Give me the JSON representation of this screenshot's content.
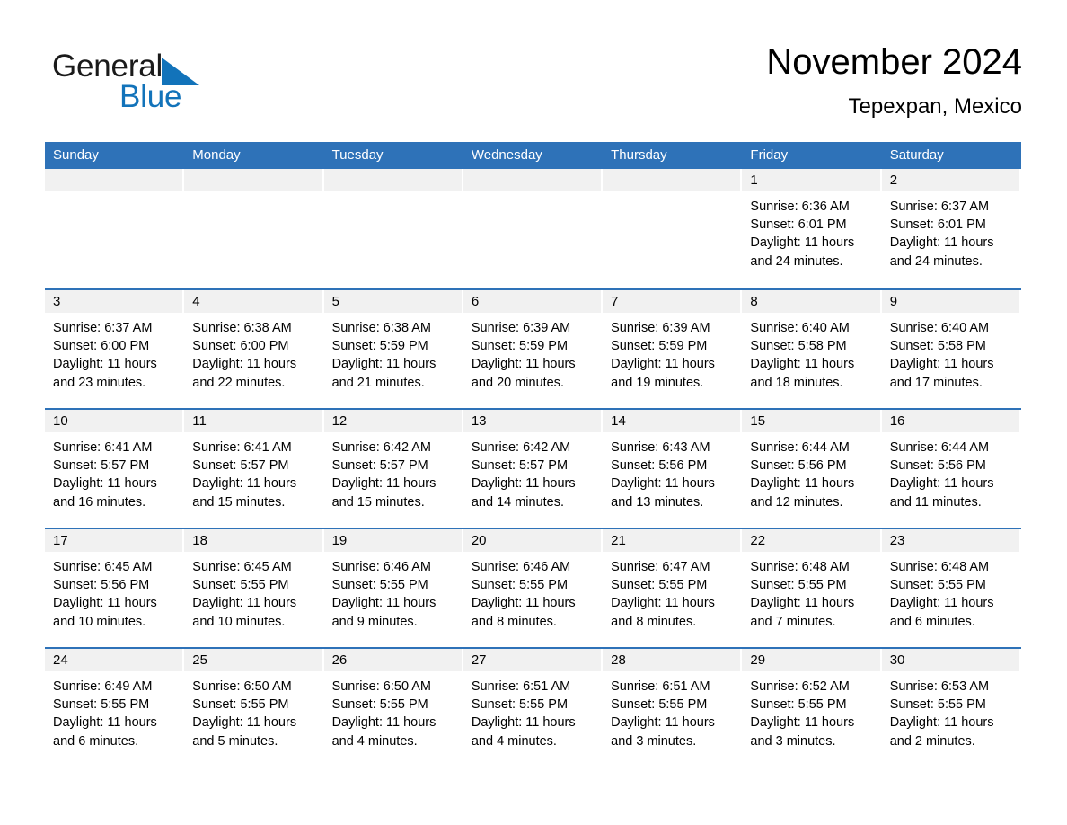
{
  "brand": {
    "name_part1": "General",
    "name_part2": "Blue",
    "triangle_color": "#1273ba",
    "text_color": "#1a1a1a"
  },
  "header": {
    "month_title": "November 2024",
    "location": "Tepexpan, Mexico"
  },
  "colors": {
    "header_blue": "#2e72b8",
    "daynum_band": "#f1f1f1",
    "row_divider": "#2e72b8",
    "text": "#000000"
  },
  "calendar": {
    "weekday_headers": [
      "Sunday",
      "Monday",
      "Tuesday",
      "Wednesday",
      "Thursday",
      "Friday",
      "Saturday"
    ],
    "weeks": [
      [
        {
          "day": "",
          "sunrise": "",
          "sunset": "",
          "daylight": "",
          "empty": true
        },
        {
          "day": "",
          "sunrise": "",
          "sunset": "",
          "daylight": "",
          "empty": true
        },
        {
          "day": "",
          "sunrise": "",
          "sunset": "",
          "daylight": "",
          "empty": true
        },
        {
          "day": "",
          "sunrise": "",
          "sunset": "",
          "daylight": "",
          "empty": true
        },
        {
          "day": "",
          "sunrise": "",
          "sunset": "",
          "daylight": "",
          "empty": true
        },
        {
          "day": "1",
          "sunrise": "Sunrise: 6:36 AM",
          "sunset": "Sunset: 6:01 PM",
          "daylight": "Daylight: 11 hours and 24 minutes."
        },
        {
          "day": "2",
          "sunrise": "Sunrise: 6:37 AM",
          "sunset": "Sunset: 6:01 PM",
          "daylight": "Daylight: 11 hours and 24 minutes."
        }
      ],
      [
        {
          "day": "3",
          "sunrise": "Sunrise: 6:37 AM",
          "sunset": "Sunset: 6:00 PM",
          "daylight": "Daylight: 11 hours and 23 minutes."
        },
        {
          "day": "4",
          "sunrise": "Sunrise: 6:38 AM",
          "sunset": "Sunset: 6:00 PM",
          "daylight": "Daylight: 11 hours and 22 minutes."
        },
        {
          "day": "5",
          "sunrise": "Sunrise: 6:38 AM",
          "sunset": "Sunset: 5:59 PM",
          "daylight": "Daylight: 11 hours and 21 minutes."
        },
        {
          "day": "6",
          "sunrise": "Sunrise: 6:39 AM",
          "sunset": "Sunset: 5:59 PM",
          "daylight": "Daylight: 11 hours and 20 minutes."
        },
        {
          "day": "7",
          "sunrise": "Sunrise: 6:39 AM",
          "sunset": "Sunset: 5:59 PM",
          "daylight": "Daylight: 11 hours and 19 minutes."
        },
        {
          "day": "8",
          "sunrise": "Sunrise: 6:40 AM",
          "sunset": "Sunset: 5:58 PM",
          "daylight": "Daylight: 11 hours and 18 minutes."
        },
        {
          "day": "9",
          "sunrise": "Sunrise: 6:40 AM",
          "sunset": "Sunset: 5:58 PM",
          "daylight": "Daylight: 11 hours and 17 minutes."
        }
      ],
      [
        {
          "day": "10",
          "sunrise": "Sunrise: 6:41 AM",
          "sunset": "Sunset: 5:57 PM",
          "daylight": "Daylight: 11 hours and 16 minutes."
        },
        {
          "day": "11",
          "sunrise": "Sunrise: 6:41 AM",
          "sunset": "Sunset: 5:57 PM",
          "daylight": "Daylight: 11 hours and 15 minutes."
        },
        {
          "day": "12",
          "sunrise": "Sunrise: 6:42 AM",
          "sunset": "Sunset: 5:57 PM",
          "daylight": "Daylight: 11 hours and 15 minutes."
        },
        {
          "day": "13",
          "sunrise": "Sunrise: 6:42 AM",
          "sunset": "Sunset: 5:57 PM",
          "daylight": "Daylight: 11 hours and 14 minutes."
        },
        {
          "day": "14",
          "sunrise": "Sunrise: 6:43 AM",
          "sunset": "Sunset: 5:56 PM",
          "daylight": "Daylight: 11 hours and 13 minutes."
        },
        {
          "day": "15",
          "sunrise": "Sunrise: 6:44 AM",
          "sunset": "Sunset: 5:56 PM",
          "daylight": "Daylight: 11 hours and 12 minutes."
        },
        {
          "day": "16",
          "sunrise": "Sunrise: 6:44 AM",
          "sunset": "Sunset: 5:56 PM",
          "daylight": "Daylight: 11 hours and 11 minutes."
        }
      ],
      [
        {
          "day": "17",
          "sunrise": "Sunrise: 6:45 AM",
          "sunset": "Sunset: 5:56 PM",
          "daylight": "Daylight: 11 hours and 10 minutes."
        },
        {
          "day": "18",
          "sunrise": "Sunrise: 6:45 AM",
          "sunset": "Sunset: 5:55 PM",
          "daylight": "Daylight: 11 hours and 10 minutes."
        },
        {
          "day": "19",
          "sunrise": "Sunrise: 6:46 AM",
          "sunset": "Sunset: 5:55 PM",
          "daylight": "Daylight: 11 hours and 9 minutes."
        },
        {
          "day": "20",
          "sunrise": "Sunrise: 6:46 AM",
          "sunset": "Sunset: 5:55 PM",
          "daylight": "Daylight: 11 hours and 8 minutes."
        },
        {
          "day": "21",
          "sunrise": "Sunrise: 6:47 AM",
          "sunset": "Sunset: 5:55 PM",
          "daylight": "Daylight: 11 hours and 8 minutes."
        },
        {
          "day": "22",
          "sunrise": "Sunrise: 6:48 AM",
          "sunset": "Sunset: 5:55 PM",
          "daylight": "Daylight: 11 hours and 7 minutes."
        },
        {
          "day": "23",
          "sunrise": "Sunrise: 6:48 AM",
          "sunset": "Sunset: 5:55 PM",
          "daylight": "Daylight: 11 hours and 6 minutes."
        }
      ],
      [
        {
          "day": "24",
          "sunrise": "Sunrise: 6:49 AM",
          "sunset": "Sunset: 5:55 PM",
          "daylight": "Daylight: 11 hours and 6 minutes."
        },
        {
          "day": "25",
          "sunrise": "Sunrise: 6:50 AM",
          "sunset": "Sunset: 5:55 PM",
          "daylight": "Daylight: 11 hours and 5 minutes."
        },
        {
          "day": "26",
          "sunrise": "Sunrise: 6:50 AM",
          "sunset": "Sunset: 5:55 PM",
          "daylight": "Daylight: 11 hours and 4 minutes."
        },
        {
          "day": "27",
          "sunrise": "Sunrise: 6:51 AM",
          "sunset": "Sunset: 5:55 PM",
          "daylight": "Daylight: 11 hours and 4 minutes."
        },
        {
          "day": "28",
          "sunrise": "Sunrise: 6:51 AM",
          "sunset": "Sunset: 5:55 PM",
          "daylight": "Daylight: 11 hours and 3 minutes."
        },
        {
          "day": "29",
          "sunrise": "Sunrise: 6:52 AM",
          "sunset": "Sunset: 5:55 PM",
          "daylight": "Daylight: 11 hours and 3 minutes."
        },
        {
          "day": "30",
          "sunrise": "Sunrise: 6:53 AM",
          "sunset": "Sunset: 5:55 PM",
          "daylight": "Daylight: 11 hours and 2 minutes."
        }
      ]
    ]
  }
}
